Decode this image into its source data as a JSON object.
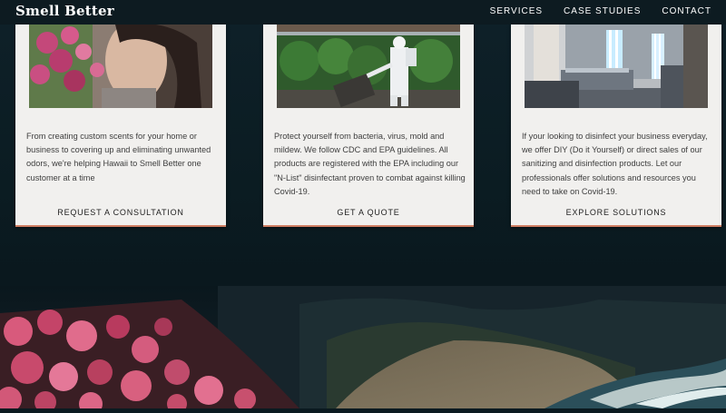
{
  "brand": {
    "logo_text": "Smell Better"
  },
  "nav": {
    "items": [
      {
        "label": "SERVICES"
      },
      {
        "label": "CASE STUDIES"
      },
      {
        "label": "CONTACT"
      }
    ]
  },
  "cards": [
    {
      "description": "From creating custom scents for your home or business to covering up and eliminating unwanted odors, we're helping Hawaii to Smell Better one customer at a time",
      "cta": "REQUEST A CONSULTATION"
    },
    {
      "description": "Protect yourself from bacteria, virus, mold and mildew. We follow CDC and EPA guidelines. All products are registered with the EPA including our \"N-List\" disinfectant proven to combat against killing Covid-19.",
      "cta": "GET A QUOTE"
    },
    {
      "description": "If your looking to disinfect your business everyday, we offer DIY (Do it Yourself) or direct sales of our sanitizing and disinfection products. Let our professionals offer solutions and resources you need to take on Covid-19.",
      "cta": "EXPLORE SOLUTIONS"
    }
  ],
  "colors": {
    "navbar_bg": "#0d1b21",
    "page_bg": "#0b1a20",
    "card_bg": "#f1f0ee",
    "card_accent": "#cf7e63",
    "text": "#3e3e3e"
  }
}
